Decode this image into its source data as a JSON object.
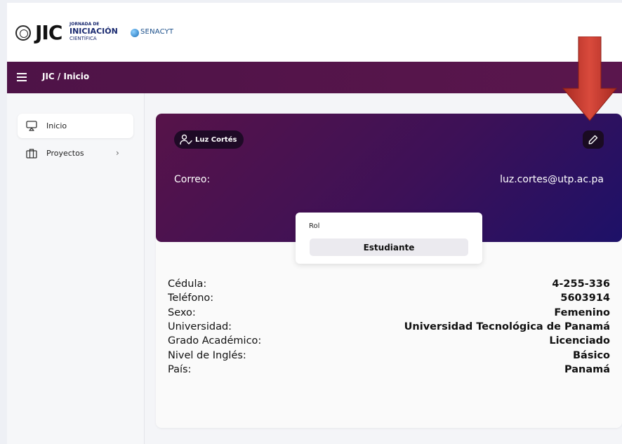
{
  "logo": {
    "jic": "JIC",
    "jornada": "JORNADA DE",
    "iniciacion": "INICIACIÓN",
    "cientifica": "CIENTÍFICA",
    "senacyt": "SENACYT"
  },
  "header": {
    "breadcrumb": "JIC / Inicio"
  },
  "sidebar": {
    "items": [
      {
        "label": "Inicio",
        "icon": "airplay-icon",
        "active": true
      },
      {
        "label": "Proyectos",
        "icon": "briefcase-icon",
        "active": false,
        "has_submenu": true
      }
    ]
  },
  "profile": {
    "name": "Luz Cortés",
    "email_label": "Correo:",
    "email": "luz.cortes@utp.ac.pa",
    "role_label": "Rol",
    "role": "Estudiante",
    "fields": [
      {
        "label": "Cédula:",
        "value": "4-255-336"
      },
      {
        "label": "Teléfono:",
        "value": "5603914"
      },
      {
        "label": "Sexo:",
        "value": "Femenino"
      },
      {
        "label": "Universidad:",
        "value": "Universidad Tecnológica de Panamá"
      },
      {
        "label": "Grado Académico:",
        "value": "Licenciado"
      },
      {
        "label": "Nivel de Inglés:",
        "value": "Básico"
      },
      {
        "label": "País:",
        "value": "Panamá"
      }
    ]
  },
  "colors": {
    "header_purple": "#4e1347",
    "card_gradient_start": "#571349",
    "card_gradient_end": "#1d1168",
    "arrow_red": "#c8372c"
  }
}
